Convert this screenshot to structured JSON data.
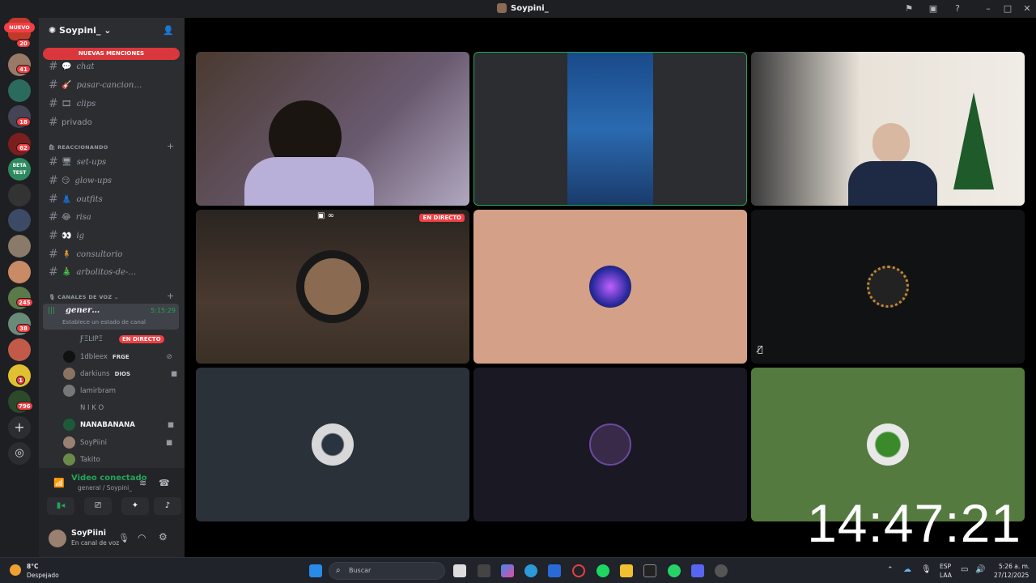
{
  "window": {
    "title": "Soypini_"
  },
  "guilds": {
    "new_label": "NUEVO",
    "badges": [
      "20",
      "41",
      "18",
      "62",
      "245",
      "38",
      "1",
      "796"
    ],
    "beta_label": "BETA TEST"
  },
  "server": {
    "name": "Soypini_",
    "new_mentions": "NUEVAS MENCIONES",
    "text_channels": [
      {
        "name": "chat",
        "emoji": "💬"
      },
      {
        "name": "pasar-cancion…",
        "emoji": "🎸"
      },
      {
        "name": "clips",
        "emoji": "🎞"
      },
      {
        "name": "privado",
        "emoji": ""
      }
    ],
    "category_reaccionando": "REACCIONANDO",
    "react_channels": [
      {
        "name": "set-ups",
        "emoji": "🖥"
      },
      {
        "name": "glow-ups",
        "emoji": "😏"
      },
      {
        "name": "outfits",
        "emoji": "👗"
      },
      {
        "name": "risa",
        "emoji": "😂"
      },
      {
        "name": "ig",
        "emoji": "👀"
      },
      {
        "name": "consultorio",
        "emoji": "🧍"
      },
      {
        "name": "arbolitos-de-…",
        "emoji": "🎄"
      }
    ],
    "category_voz": "CANALES DE VOZ",
    "voice_channel": {
      "name": "gener…",
      "time": "5:15:29",
      "status": "Establece un estado de canal"
    },
    "voice_users": [
      {
        "name": "ƑΞĿIPΞ",
        "tag": "",
        "live": "EN DIRECTO"
      },
      {
        "name": "1dbleex",
        "tag": "FRGE",
        "live": ""
      },
      {
        "name": "darkiuns",
        "tag": "DIOS",
        "live": ""
      },
      {
        "name": "lamirbram",
        "tag": "",
        "live": ""
      },
      {
        "name": "N I K O",
        "tag": "",
        "live": ""
      },
      {
        "name": "NANABANANA",
        "tag": "",
        "live": ""
      },
      {
        "name": "SoyPiini",
        "tag": "",
        "live": ""
      },
      {
        "name": "Takito",
        "tag": "",
        "live": ""
      }
    ]
  },
  "rtc": {
    "status": "Video conectado",
    "channel": "general / Soypini_"
  },
  "user": {
    "name": "SoyPiini",
    "status": "En canal de voz"
  },
  "stage": {
    "live_label": "EN DIRECTO",
    "clock": "14:47:21"
  },
  "taskbar": {
    "weather_temp": "8°C",
    "weather_desc": "Despejado",
    "search_placeholder": "Buscar",
    "lang1": "ESP",
    "lang2": "LAA",
    "time": "5:26 a. m.",
    "date": "27/12/2025"
  }
}
